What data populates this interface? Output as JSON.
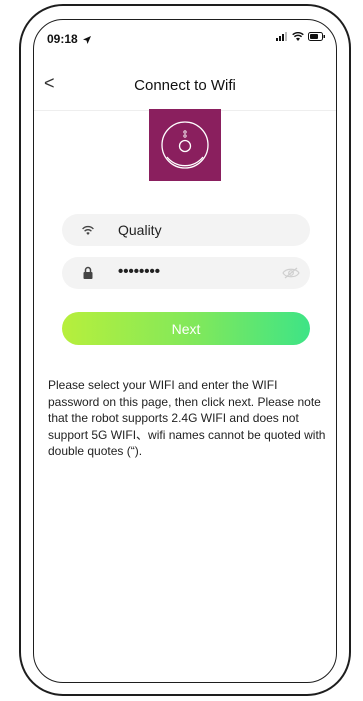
{
  "status_bar": {
    "time": "09:18"
  },
  "nav": {
    "back_label": "<",
    "title": "Connect to Wifi"
  },
  "wifi": {
    "ssid": "Quality"
  },
  "password": {
    "masked_value": "••••••••"
  },
  "actions": {
    "next_label": "Next"
  },
  "notice": "Please select your WIFI and enter the WIFI password on this page, then click next. Please note that the robot supports 2.4G WIFI and does not support 5G WIFI、wifi names cannot be quoted with double quotes (“).",
  "colors": {
    "logo_bg": "#8a1f5e",
    "button_start": "#b7ef3c",
    "button_end": "#3ee486"
  },
  "icons": [
    "location-arrow-icon",
    "signal-icon",
    "wifi-icon",
    "battery-icon",
    "robot-vacuum-icon",
    "wifi-icon",
    "lock-icon",
    "eye-off-icon"
  ]
}
